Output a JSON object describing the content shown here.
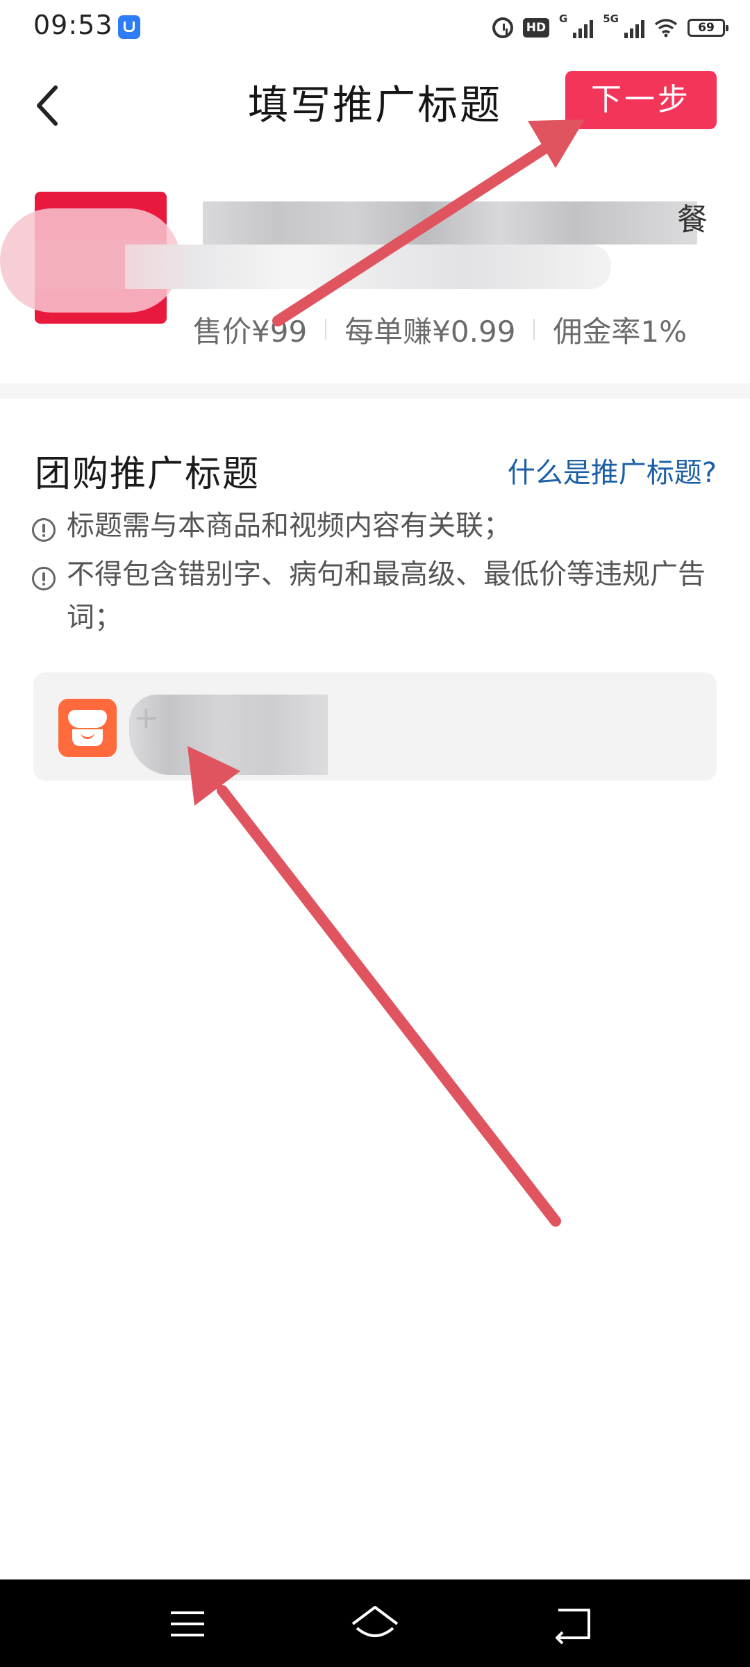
{
  "status_bar": {
    "time": "09:53",
    "hd_label": "HD",
    "net1_label": "G",
    "net2_label": "5G",
    "battery": "69"
  },
  "header": {
    "title": "填写推广标题",
    "next_button": "下一步"
  },
  "product": {
    "title_tail": "餐",
    "metrics": [
      "售价¥99",
      "每单赚¥0.99",
      "佣金率1%"
    ]
  },
  "promo": {
    "section_title": "团购推广标题",
    "help_link": "什么是推广标题?",
    "tips": [
      "标题需与本商品和视频内容有关联；",
      "不得包含错别字、病句和最高级、最低价等违规广告词；"
    ],
    "input_prefix": "+"
  },
  "colors": {
    "accent": "#f3355a",
    "link": "#1b5fa6",
    "arrow": "#e0545f",
    "shop_icon": "#ff6a3d"
  },
  "icons": {
    "back": "back-arrow-icon",
    "tip": "exclamation-circle-icon",
    "shop": "store-icon",
    "nav_menu": "menu-icon",
    "nav_home": "home-icon",
    "nav_back": "return-icon"
  }
}
